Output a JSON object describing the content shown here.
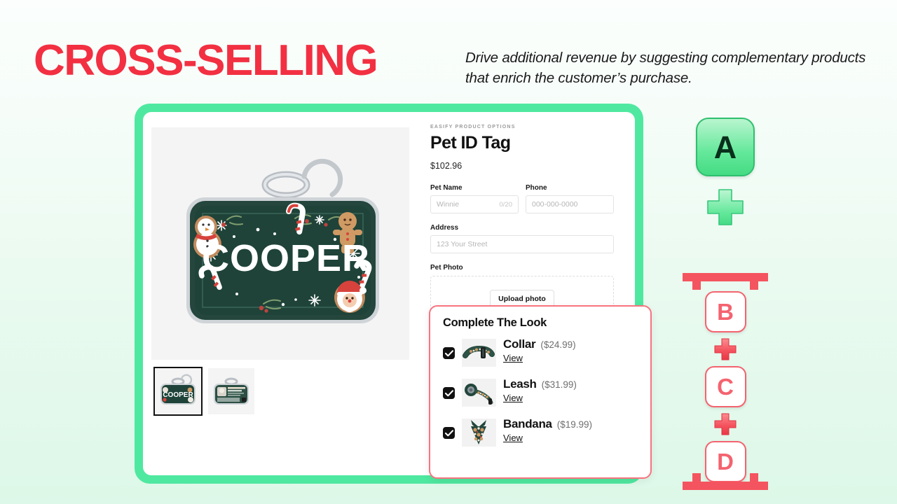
{
  "header": {
    "title": "CROSS-SELLING",
    "subtitle": "Drive additional revenue by suggesting complementary products that enrich the customer’s purchase.",
    "title_color": "#f23042"
  },
  "colors": {
    "accent_green": "#4fe8a0",
    "accent_red": "#f4636f",
    "title_red": "#f23042",
    "background_top": "#fbfefc",
    "background_bottom": "#ddf8e8"
  },
  "product": {
    "brand_line": "EASIFY PRODUCT OPTIONS",
    "name": "Pet ID Tag",
    "price": "$102.96",
    "tag_text": "COOPER",
    "fields": [
      {
        "label": "Pet Name",
        "placeholder": "Winnie",
        "counter": "0/20",
        "value": ""
      },
      {
        "label": "Phone",
        "placeholder": "000-000-0000",
        "value": ""
      },
      {
        "label": "Address",
        "placeholder": "123 Your Street",
        "value": ""
      }
    ],
    "photo": {
      "label": "Pet Photo",
      "upload_button": "Upload photo"
    },
    "thumbnails": [
      {
        "name": "front-view",
        "selected": true
      },
      {
        "name": "back-view",
        "selected": false
      }
    ]
  },
  "complete_the_look": {
    "title": "Complete The Look",
    "view_label": "View",
    "items": [
      {
        "name": "Collar",
        "price": "($24.99)",
        "checked": true
      },
      {
        "name": "Leash",
        "price": "($31.99)",
        "checked": true
      },
      {
        "name": "Bandana",
        "price": "($19.99)",
        "checked": true
      }
    ]
  },
  "diagram": {
    "main": {
      "letter": "A"
    },
    "plus_top": "+",
    "addons": [
      {
        "letter": "B"
      },
      {
        "letter": "C"
      },
      {
        "letter": "D"
      }
    ],
    "plus_between": "+"
  }
}
